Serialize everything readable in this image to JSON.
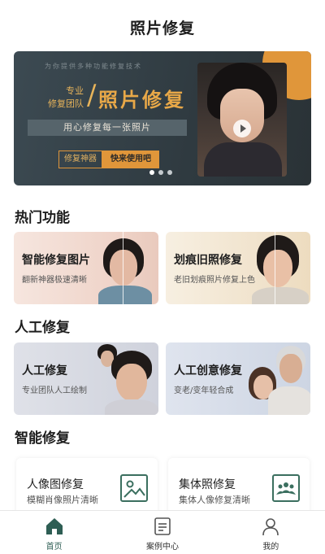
{
  "header": {
    "title": "照片修复"
  },
  "banner": {
    "tagline": "为你提供多种功能修复技术",
    "sub_line1": "专业",
    "sub_line2": "修复团队",
    "slash": "/",
    "headline": "照片修复",
    "strip_text": "用心修复每一张照片",
    "button_tag": "修复神器",
    "button_cta": "快来使用吧",
    "slide_count": 3,
    "active_slide": 1,
    "accent_color": "#e0963a"
  },
  "hot": {
    "title": "热门功能",
    "cards": [
      {
        "title": "智能修复图片",
        "subtitle": "翻新神器极速清晰"
      },
      {
        "title": "划痕旧照修复",
        "subtitle": "老旧划痕照片修复上色"
      }
    ]
  },
  "manual": {
    "title": "人工修复",
    "cards": [
      {
        "title": "人工修复",
        "subtitle": "专业团队人工绘制"
      },
      {
        "title": "人工创意修复",
        "subtitle": "变老/变年轻合成"
      }
    ]
  },
  "smart": {
    "title": "智能修复",
    "cards": [
      {
        "title": "人像图修复",
        "subtitle": "模糊肖像照片清晰",
        "icon": "image-icon"
      },
      {
        "title": "集体照修复",
        "subtitle": "集体人像修复清晰",
        "icon": "group-photo-icon"
      }
    ]
  },
  "nav": {
    "items": [
      {
        "label": "首页",
        "icon": "home-icon",
        "active": true
      },
      {
        "label": "案例中心",
        "icon": "document-icon",
        "active": false
      },
      {
        "label": "我的",
        "icon": "user-icon",
        "active": false
      }
    ],
    "active_color": "#2e5e54"
  }
}
